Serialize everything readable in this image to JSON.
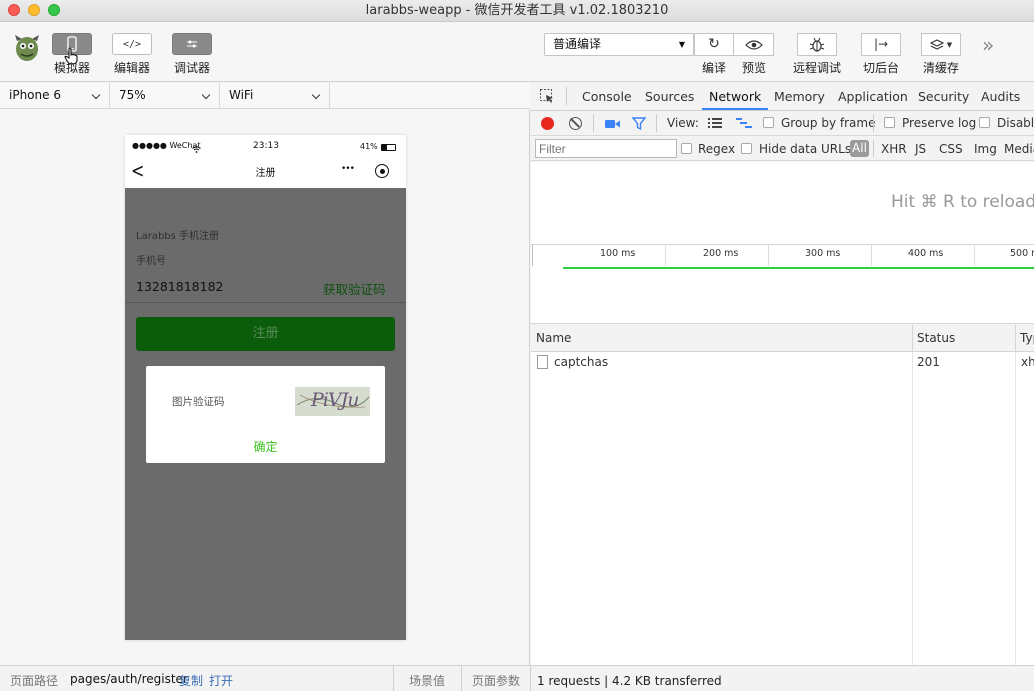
{
  "window": {
    "title": "larabbs-weapp - 微信开发者工具 v1.02.1803210"
  },
  "toolbar": {
    "simulator_label": "模拟器",
    "editor_label": "编辑器",
    "debugger_label": "调试器",
    "compile_mode": "普通编译",
    "compile_label": "编译",
    "preview_label": "预览",
    "remote_debug_label": "远程调试",
    "background_label": "切后台",
    "clear_cache_label": "清缓存",
    "more_glyph": "»",
    "refresh_glyph": "↻",
    "background_glyph": "|→"
  },
  "simulator": {
    "device": "iPhone 6",
    "zoom": "75%",
    "network": "WiFi"
  },
  "phone": {
    "carrier": "●●●●● WeChat",
    "time": "23:13",
    "battery": "41%",
    "page_title": "注册",
    "back_glyph": "<",
    "more_glyph": "•••",
    "form": {
      "heading": "Larabbs 手机注册",
      "phone_label": "手机号",
      "phone_value": "13281818182",
      "get_code_label": "获取验证码",
      "register_label": "注册"
    },
    "captcha_modal": {
      "label": "图片验证码",
      "captcha_text": "PiVJu",
      "confirm_label": "确定"
    }
  },
  "devtools": {
    "tabs": [
      "Console",
      "Sources",
      "Network",
      "Memory",
      "Application",
      "Security",
      "Audits"
    ],
    "active_tab": "Network",
    "view_label": "View:",
    "group_by_frame": "Group by frame",
    "preserve_log": "Preserve log",
    "disable_cache": "Disable",
    "filter_placeholder": "Filter",
    "regex": "Regex",
    "hide_data_urls": "Hide data URLs",
    "type_filters": [
      "All",
      "XHR",
      "JS",
      "CSS",
      "Img",
      "Media"
    ],
    "hint": "Hit ⌘ R to reload",
    "timeline_ticks": [
      "100 ms",
      "200 ms",
      "300 ms",
      "400 ms",
      "500 m"
    ],
    "columns": {
      "name": "Name",
      "status": "Status",
      "type": "Typ"
    },
    "rows": [
      {
        "name": "captchas",
        "status": "201",
        "type": "xh"
      }
    ],
    "summary": "1 requests | 4.2 KB transferred"
  },
  "statusbar": {
    "path_label": "页面路径",
    "path": "pages/auth/register",
    "copy": "复制",
    "open": "打开",
    "scene": "场景值",
    "params": "页面参数"
  },
  "colors": {
    "accent_green": "#3cc51f",
    "register_green": "#0b5c0b",
    "devtools_blue": "#3b82f6",
    "record_red": "#e8281f"
  }
}
